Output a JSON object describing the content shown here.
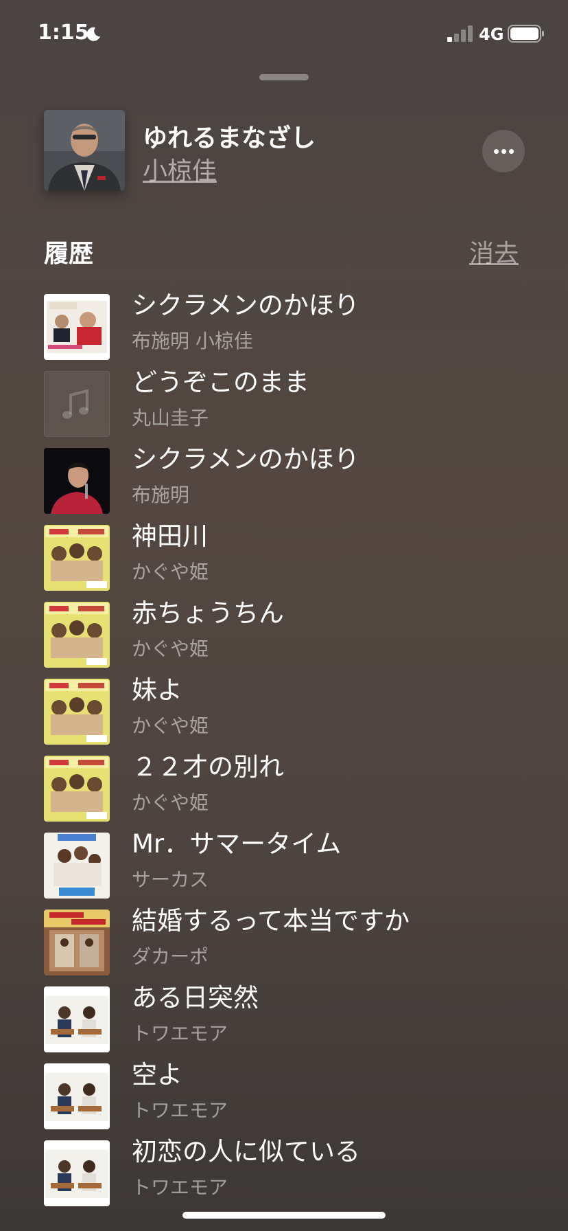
{
  "status_bar": {
    "time": "1:15",
    "network": "4G"
  },
  "now_playing": {
    "title": "ゆれるまなざし",
    "artist": "小椋佳"
  },
  "history": {
    "title": "履歴",
    "clear_label": "消去",
    "items": [
      {
        "title": "シクラメンのかほり",
        "artist": "布施明 小椋佳",
        "art": "duet-cover"
      },
      {
        "title": "どうぞこのまま",
        "artist": "丸山圭子",
        "art": "music-note-placeholder"
      },
      {
        "title": "シクラメンのかほり",
        "artist": "布施明",
        "art": "concert-photo"
      },
      {
        "title": "神田川",
        "artist": "かぐや姫",
        "art": "kaguyahime-cover"
      },
      {
        "title": "赤ちょうちん",
        "artist": "かぐや姫",
        "art": "kaguyahime-cover"
      },
      {
        "title": "妹よ",
        "artist": "かぐや姫",
        "art": "kaguyahime-cover"
      },
      {
        "title": "２２才の別れ",
        "artist": "かぐや姫",
        "art": "kaguyahime-cover"
      },
      {
        "title": "Mr．サマータイム",
        "artist": "サーカス",
        "art": "circus-cover"
      },
      {
        "title": "結婚するって本当ですか",
        "artist": "ダカーポ",
        "art": "dacapo-cover"
      },
      {
        "title": "ある日突然",
        "artist": "トワエモア",
        "art": "guitar-duo-cover"
      },
      {
        "title": "空よ",
        "artist": "トワエモア",
        "art": "guitar-duo-cover"
      },
      {
        "title": "初恋の人に似ている",
        "artist": "トワエモア",
        "art": "guitar-duo-cover"
      }
    ]
  }
}
